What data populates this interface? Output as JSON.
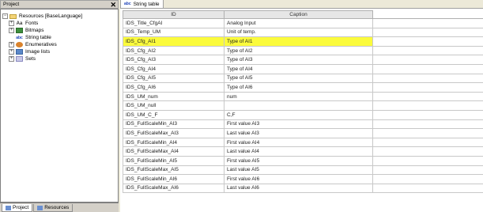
{
  "project_panel": {
    "title": "Project",
    "close_label": "✕",
    "tree": [
      {
        "label": "Resources [BaseLanguage]",
        "expander": "−",
        "icon": "folder-icon",
        "depth": 0
      },
      {
        "label": "Fonts",
        "expander": "+",
        "icon": "fonts-icon",
        "depth": 1
      },
      {
        "label": "Bitmaps",
        "expander": "+",
        "icon": "bitmaps-icon",
        "depth": 1
      },
      {
        "label": "String table",
        "expander": "",
        "icon": "string-table-icon",
        "depth": 1
      },
      {
        "label": "Enumeratives",
        "expander": "+",
        "icon": "enumeratives-icon",
        "depth": 1
      },
      {
        "label": "Image lists",
        "expander": "+",
        "icon": "image-lists-icon",
        "depth": 1
      },
      {
        "label": "Sets",
        "expander": "+",
        "icon": "sets-icon",
        "depth": 1
      }
    ],
    "bottom_tabs": [
      {
        "label": "Project",
        "active": true
      },
      {
        "label": "Resources",
        "active": false
      }
    ]
  },
  "editor": {
    "tab_label": "String table",
    "columns": {
      "id": "ID",
      "caption": "Caption"
    },
    "rows": [
      {
        "id": "IDS_Title_CfgAI",
        "caption": "Analog Input",
        "selected": false
      },
      {
        "id": "IDS_Temp_UM",
        "caption": "Unit of temp.",
        "selected": false
      },
      {
        "id": "IDS_Cfg_AI1",
        "caption": "Type of AI1",
        "selected": true
      },
      {
        "id": "IDS_Cfg_AI2",
        "caption": "Type of AI2",
        "selected": false
      },
      {
        "id": "IDS_Cfg_AI3",
        "caption": "Type of AI3",
        "selected": false
      },
      {
        "id": "IDS_Cfg_AI4",
        "caption": "Type of AI4",
        "selected": false
      },
      {
        "id": "IDS_Cfg_AI5",
        "caption": "Type of AI5",
        "selected": false
      },
      {
        "id": "IDS_Cfg_AI6",
        "caption": "Type of AI6",
        "selected": false
      },
      {
        "id": "IDS_UM_num",
        "caption": "num",
        "selected": false
      },
      {
        "id": "IDS_UM_null",
        "caption": "",
        "selected": false
      },
      {
        "id": "IDS_UM_C_F",
        "caption": "C,F",
        "selected": false
      },
      {
        "id": "IDS_FullScaleMin_AI3",
        "caption": "First value AI3",
        "selected": false
      },
      {
        "id": "IDS_FullScaleMax_AI3",
        "caption": "Last value AI3",
        "selected": false
      },
      {
        "id": "IDS_FullScaleMin_AI4",
        "caption": "First value AI4",
        "selected": false
      },
      {
        "id": "IDS_FullScaleMax_AI4",
        "caption": "Last value AI4",
        "selected": false
      },
      {
        "id": "IDS_FullScaleMin_AI5",
        "caption": "First value AI5",
        "selected": false
      },
      {
        "id": "IDS_FullScaleMax_AI5",
        "caption": "Last value AI5",
        "selected": false
      },
      {
        "id": "IDS_FullScaleMin_AI6",
        "caption": "First value AI6",
        "selected": false
      },
      {
        "id": "IDS_FullScaleMax_AI6",
        "caption": "Last value AI6",
        "selected": false
      }
    ]
  },
  "colors": {
    "selection": "#fbfb3c",
    "header_bg": "#e6e6e6"
  }
}
